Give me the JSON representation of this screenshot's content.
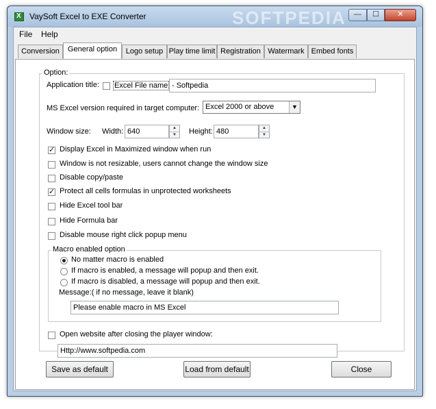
{
  "window": {
    "title": "VaySoft Excel to EXE Converter",
    "watermark": "SOFTPEDIA",
    "controls": {
      "minimize": "—",
      "maximize": "☐",
      "close": "✕"
    }
  },
  "menu": [
    "File",
    "Help"
  ],
  "tabs": [
    "Conversion",
    "General option",
    "Logo setup",
    "Play time limit",
    "Registration",
    "Watermark",
    "Embed fonts"
  ],
  "active_tab": "General option",
  "option_group": {
    "label": "Option:",
    "app_title": {
      "label": "Application title:",
      "checkbox_label": "Excel File name",
      "checked": false,
      "value": "- Softpedia"
    },
    "excel_version": {
      "label": "MS Excel version required in target computer:",
      "selected": "Excel 2000 or above"
    },
    "window_size": {
      "label": "Window size:",
      "width_label": "Width:",
      "width": "640",
      "height_label": "Height:",
      "height": "480"
    },
    "checkboxes": [
      {
        "label": "Display Excel in Maximized window when run",
        "checked": true
      },
      {
        "label": "Window is not resizable, users cannot change the window size",
        "checked": false
      },
      {
        "label": "Disable copy/paste",
        "checked": false
      },
      {
        "label": "Protect all cells formulas in unprotected worksheets",
        "checked": true
      },
      {
        "label": "Hide Excel tool bar",
        "checked": false
      },
      {
        "label": "Hide Formula bar",
        "checked": false
      },
      {
        "label": "Disable mouse right click popup menu",
        "checked": false
      }
    ],
    "macro": {
      "label": "Macro enabled option",
      "options": [
        {
          "label": "No matter macro is enabled",
          "selected": true
        },
        {
          "label": "If macro is enabled, a message will popup and then exit.",
          "selected": false
        },
        {
          "label": "If macro is disabled, a message will popup and then exit.",
          "selected": false
        }
      ],
      "message_label": "Message:( if no message, leave it blank)",
      "message_value": "Please enable macro in MS Excel"
    },
    "website": {
      "label": "Open website after closing the player window:",
      "checked": false,
      "url": "Http://www.softpedia.com"
    }
  },
  "buttons": {
    "save_default": "Save as default",
    "load_default": "Load from default",
    "close": "Close"
  }
}
